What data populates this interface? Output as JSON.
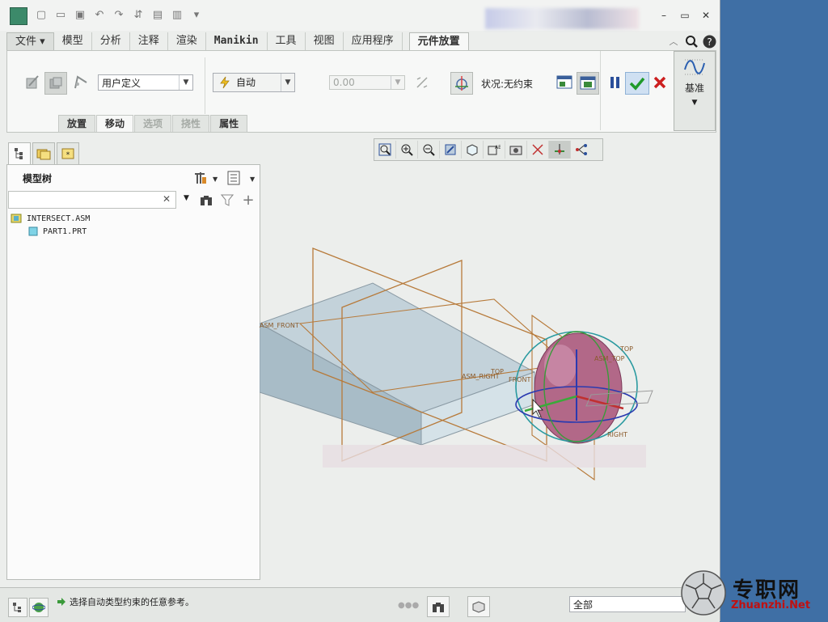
{
  "file_tab": "文件",
  "tabs": [
    "模型",
    "分析",
    "注释",
    "渲染",
    "Manikin",
    "工具",
    "视图",
    "应用程序",
    "元件放置"
  ],
  "ribbon": {
    "constraint_type": "用户定义",
    "auto_label": "自动",
    "offset_value": "0.00",
    "status_label": "状况:无约束",
    "datum_label": "基准"
  },
  "subtabs": [
    "放置",
    "移动",
    "选项",
    "挠性",
    "属性"
  ],
  "model_tree": {
    "title": "模型树",
    "items": [
      "INTERSECT.ASM",
      "PART1.PRT"
    ]
  },
  "datum_labels": {
    "asm_front": "ASM_FRONT",
    "top": "TOP",
    "asm_top": "ASM_TOP",
    "right": "RIGHT",
    "asm_right": "ASM_RIGHT",
    "front": "FRONT"
  },
  "status": {
    "message": "选择自动类型约束的任意参考。",
    "filter_value": "全部"
  },
  "watermark": {
    "cn": "专职网",
    "en": "Zhuanzhi.Net"
  }
}
